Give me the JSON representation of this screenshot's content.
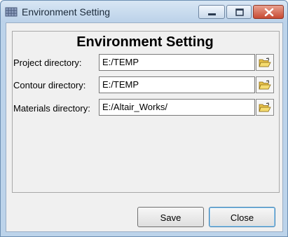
{
  "window": {
    "title": "Environment Setting",
    "icon": "grid-app-icon"
  },
  "titlebar_buttons": {
    "minimize": "minimize-icon",
    "maximize": "maximize-icon",
    "close": "close-icon"
  },
  "form": {
    "heading": "Environment Setting",
    "rows": [
      {
        "label": "Project directory:",
        "value": "E:/TEMP",
        "icon": "folder-open-icon"
      },
      {
        "label": "Contour directory:",
        "value": "E:/TEMP",
        "icon": "folder-open-icon"
      },
      {
        "label": "Materials directory:",
        "value": "E:/Altair_Works/",
        "icon": "folder-open-icon"
      }
    ]
  },
  "buttons": {
    "save": "Save",
    "close": "Close"
  },
  "colors": {
    "titlebar": "#c8dbef",
    "close_button": "#c74a32",
    "dialog_bg": "#f0f0f0"
  }
}
